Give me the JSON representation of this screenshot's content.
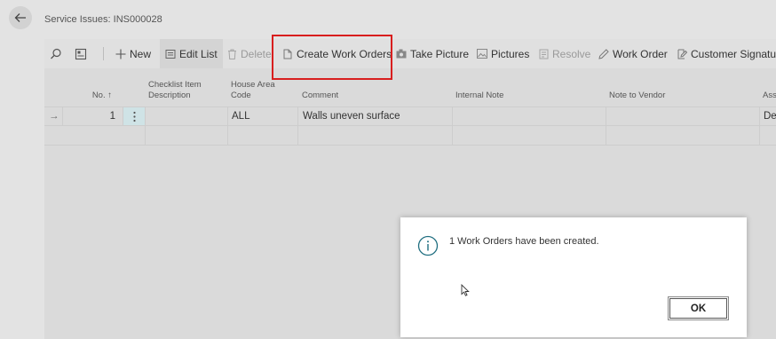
{
  "page": {
    "title": "Service Issues: INS000028"
  },
  "toolbar": {
    "new_label": "New",
    "edit_list_label": "Edit List",
    "delete_label": "Delete",
    "create_work_orders_label": "Create Work Orders",
    "take_picture_label": "Take Picture",
    "pictures_label": "Pictures",
    "resolve_label": "Resolve",
    "work_order_label": "Work Order",
    "customer_signature_label": "Customer Signature"
  },
  "grid": {
    "columns": {
      "no": "No. ↑",
      "checklist": "Checklist Item\nDescription",
      "house_area": "House Area\nCode",
      "comment": "Comment",
      "internal_note": "Internal Note",
      "note_to_vendor": "Note to Vendor",
      "assigned": "Ass"
    },
    "rows": [
      {
        "arrow": "→",
        "no": "1",
        "checklist": "",
        "house_area": "ALL",
        "comment": "Walls uneven surface",
        "internal_note": "",
        "note_to_vendor": "",
        "assigned": "De"
      }
    ]
  },
  "dialog": {
    "message": "1 Work Orders have been created.",
    "ok_label": "OK"
  },
  "colors": {
    "highlight": "#d81e1e",
    "selected_row_cell": "#cfe3e6"
  }
}
